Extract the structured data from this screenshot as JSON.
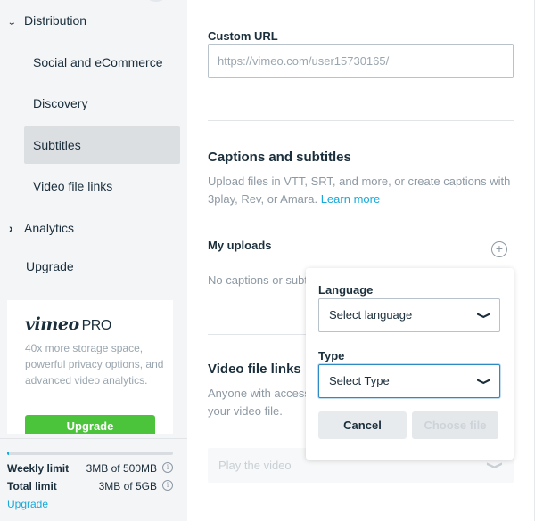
{
  "sidebar": {
    "distribution": {
      "label": "Distribution",
      "expanded": true
    },
    "distribution_children": [
      {
        "label": "Social and eCommerce",
        "active": false
      },
      {
        "label": "Discovery",
        "active": false
      },
      {
        "label": "Subtitles",
        "active": true
      },
      {
        "label": "Video file links",
        "active": false
      }
    ],
    "analytics": {
      "label": "Analytics",
      "expanded": false
    },
    "upgrade": {
      "label": "Upgrade"
    },
    "promo": {
      "brand": "vimeo",
      "tier": "PRO",
      "text": "40x more storage space, powerful privacy options, and advanced video analytics.",
      "button_label": "Upgrade",
      "button_color": "#4bc33a"
    },
    "usage": {
      "weekly_fraction": 0.006,
      "weekly": {
        "label": "Weekly limit",
        "value": "3MB of 500MB"
      },
      "total": {
        "label": "Total limit",
        "value": "3MB of 5GB"
      },
      "upgrade_link": "Upgrade",
      "info_icon": "i"
    }
  },
  "main": {
    "custom_url": {
      "label": "Custom URL",
      "placeholder": "https://vimeo.com/user15730165/"
    },
    "captions": {
      "title": "Captions and subtitles",
      "desc": "Upload files in VTT, SRT, and more, or create captions with 3play, Rev, or Amara.",
      "learn_more": "Learn more",
      "my_uploads": "My uploads",
      "add_icon": "+",
      "empty": "No captions or subtitles"
    },
    "video_file_links": {
      "title": "Video file links",
      "desc": "Anyone with access to the video can view and download your video file.",
      "select_value": "Play the video"
    }
  },
  "popover": {
    "language_label": "Language",
    "language_value": "Select language",
    "type_label": "Type",
    "type_value": "Select Type",
    "cancel_label": "Cancel",
    "choose_label": "Choose file"
  },
  "icons": {
    "chevron_down": "⌄",
    "chevron_right": "›",
    "select_chevron": "❯"
  },
  "colors": {
    "accent": "#17a9d9",
    "focus": "#2e8ac5",
    "text": "#1a2e3b",
    "muted": "#8d99a3"
  }
}
